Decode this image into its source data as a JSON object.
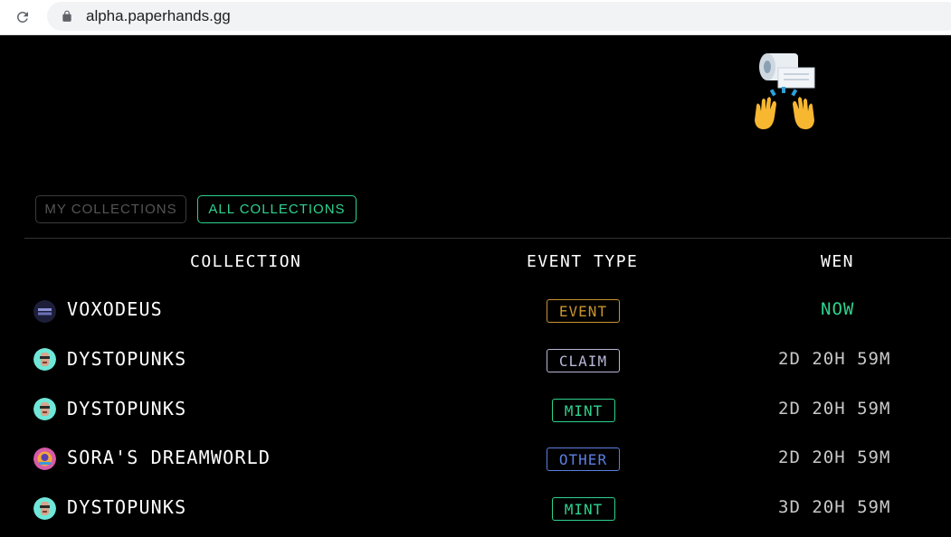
{
  "browser": {
    "url": "alpha.paperhands.gg"
  },
  "tabs": {
    "my_collections": "MY COLLECTIONS",
    "all_collections": "ALL COLLECTIONS"
  },
  "table": {
    "headers": {
      "collection": "COLLECTION",
      "event_type": "EVENT TYPE",
      "wen": "WEN"
    },
    "rows": [
      {
        "collection": "VOXODEUS",
        "event_type": "EVENT",
        "wen": "NOW",
        "icon": "voxodeus-icon",
        "badge_color": "#c9932f",
        "wen_color": "#2fd28f"
      },
      {
        "collection": "DYSTOPUNKS",
        "event_type": "CLAIM",
        "wen": "2D 20H 59M",
        "icon": "dystopunks-icon",
        "badge_color": "#b7b7d8",
        "wen_color": "#c8c8c8"
      },
      {
        "collection": "DYSTOPUNKS",
        "event_type": "MINT",
        "wen": "2D 20H 59M",
        "icon": "dystopunks-icon",
        "badge_color": "#2fd28f",
        "wen_color": "#c8c8c8"
      },
      {
        "collection": "SORA'S DREAMWORLD",
        "event_type": "OTHER",
        "wen": "2D 20H 59M",
        "icon": "sora-dreamworld-icon",
        "badge_color": "#5b7fe0",
        "wen_color": "#c8c8c8"
      },
      {
        "collection": "DYSTOPUNKS",
        "event_type": "MINT",
        "wen": "3D 20H 59M",
        "icon": "dystopunks-icon",
        "badge_color": "#2fd28f",
        "wen_color": "#c8c8c8"
      }
    ]
  },
  "colors": {
    "accent": "#2fd28f",
    "background": "#000000"
  }
}
